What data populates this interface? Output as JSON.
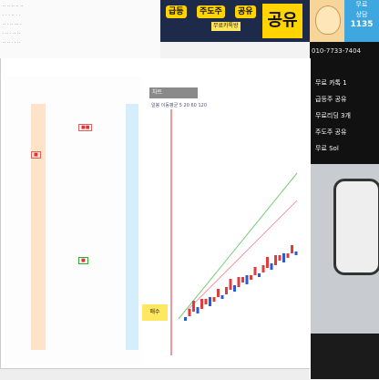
{
  "banner": {
    "tag1": "급등",
    "tag2": "주도주",
    "tag3": "공유",
    "sub": "무료카톡방",
    "big": "공유",
    "bg_color": "#1d2a4a",
    "accent_color": "#ffd400"
  },
  "phone_badge": {
    "line1": "무료",
    "line2": "상담",
    "number": "1135"
  },
  "overlay": {
    "phone": "010-7733-7404",
    "rows": [
      "무료 카톡 1",
      "급등주 공유",
      "무료리딩 3개",
      "주도주 공유",
      "무료 Sol"
    ]
  },
  "chart": {
    "header": "차트",
    "info": "일봉 이동평균 5 20 60 120",
    "price_tag": "매수",
    "up_color": "#e23b3b",
    "down_color": "#2a5bd7"
  }
}
